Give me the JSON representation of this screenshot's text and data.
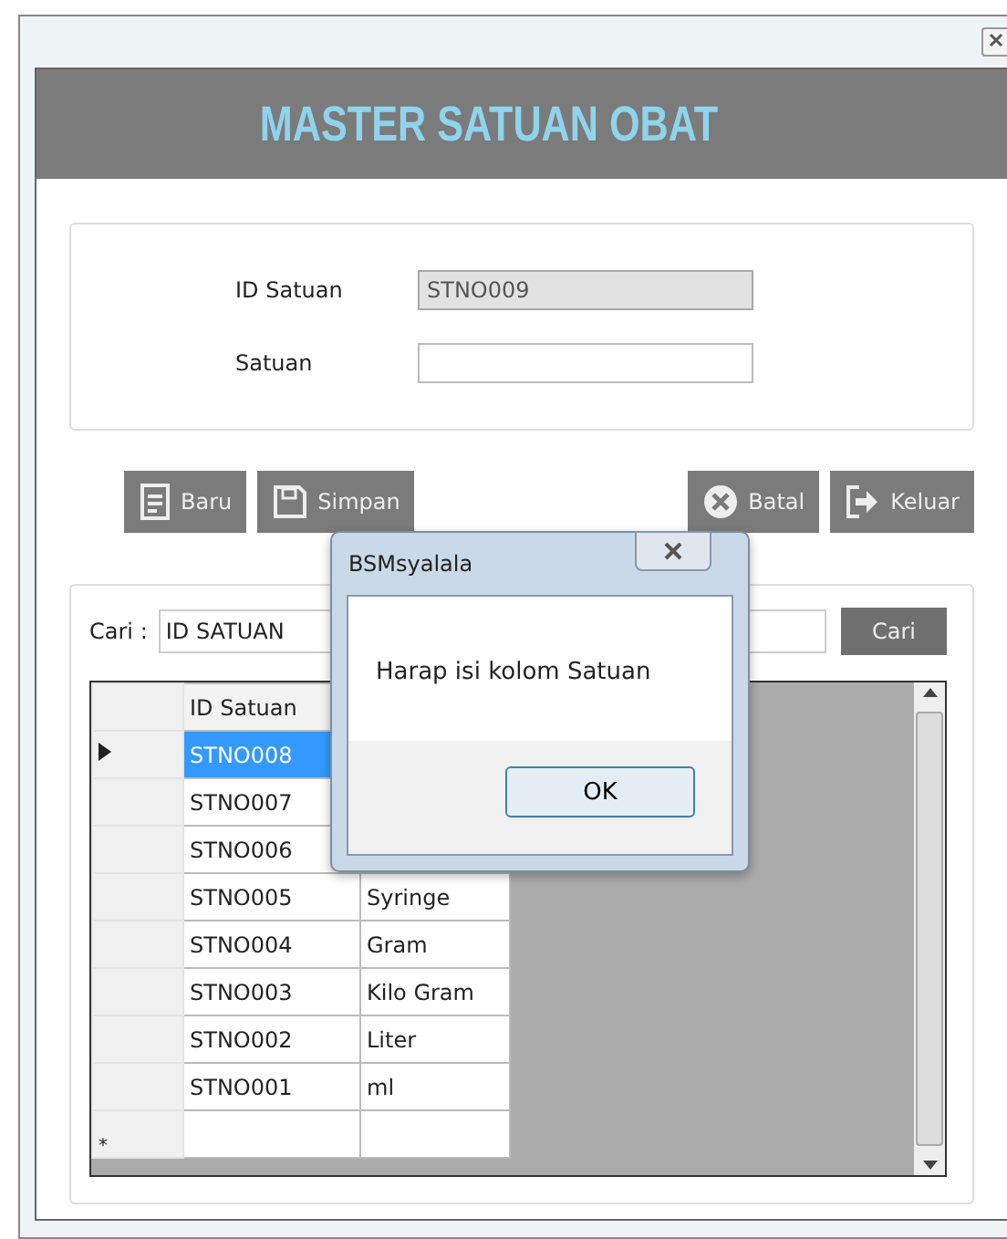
{
  "window": {
    "title": "MASTER SATUAN OBAT"
  },
  "form": {
    "fields": [
      {
        "label": "ID Satuan",
        "value": "STNO009",
        "disabled": true
      },
      {
        "label": "Satuan",
        "disabled": false
      }
    ]
  },
  "toolbar": [
    {
      "label": "Baru",
      "kind": "new"
    },
    {
      "label": "Simpan",
      "kind": "save"
    },
    {
      "label": "Batal",
      "kind": "cancel"
    },
    {
      "label": "Keluar",
      "kind": "exit"
    }
  ],
  "search": {
    "label": "Cari :",
    "field": "ID SATUAN",
    "button": "Cari"
  },
  "table": {
    "columns": [
      "ID Satuan"
    ],
    "rows": [
      {
        "id": "STNO008",
        "selected": true
      },
      {
        "id": "STNO007",
        "selected": false
      },
      {
        "id": "STNO006",
        "selected": false
      },
      {
        "id": "STNO005",
        "satuan": "Syringe",
        "selected": false
      },
      {
        "id": "STNO004",
        "satuan": "Gram",
        "selected": false
      },
      {
        "id": "STNO003",
        "satuan": "Kilo Gram",
        "selected": false
      },
      {
        "id": "STNO002",
        "satuan": "Liter",
        "selected": false
      },
      {
        "id": "STNO001",
        "satuan": "ml",
        "selected": false
      }
    ],
    "new_row_mark": "*"
  },
  "dialog": {
    "title": "BSMsyalala",
    "message": "Harap isi kolom Satuan",
    "button": "OK"
  }
}
